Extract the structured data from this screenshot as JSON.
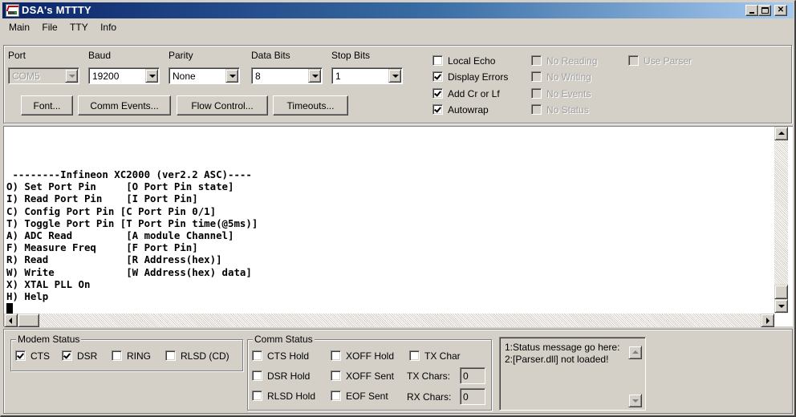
{
  "window": {
    "title": "DSA's MTTTY",
    "controls": {
      "minimize": "minimize",
      "maximize": "maximize",
      "close": "close"
    }
  },
  "menu": [
    "Main",
    "File",
    "TTY",
    "Info"
  ],
  "settings": {
    "port": {
      "label": "Port",
      "value": "COM5",
      "enabled": false
    },
    "baud": {
      "label": "Baud",
      "value": "19200"
    },
    "parity": {
      "label": "Parity",
      "value": "None"
    },
    "data_bits": {
      "label": "Data Bits",
      "value": "8"
    },
    "stop_bits": {
      "label": "Stop Bits",
      "value": "1"
    },
    "buttons": [
      "Font...",
      "Comm Events...",
      "Flow Control...",
      "Timeouts..."
    ],
    "options": [
      {
        "label": "Local Echo",
        "checked": false,
        "enabled": true
      },
      {
        "label": "Display Errors",
        "checked": true,
        "enabled": true
      },
      {
        "label": "Add Cr or Lf",
        "checked": true,
        "enabled": true
      },
      {
        "label": "Autowrap",
        "checked": true,
        "enabled": true
      },
      {
        "label": "No Reading",
        "checked": false,
        "enabled": false
      },
      {
        "label": "No Writing",
        "checked": false,
        "enabled": false
      },
      {
        "label": "No Events",
        "checked": false,
        "enabled": false
      },
      {
        "label": "No Status",
        "checked": false,
        "enabled": false
      },
      {
        "label": "Use Parser",
        "checked": false,
        "enabled": false
      }
    ]
  },
  "terminal": {
    "lines": [
      " --------Infineon XC2000 (ver2.2 ASC)----",
      "O) Set Port Pin     [O Port Pin state]",
      "I) Read Port Pin    [I Port Pin]",
      "C) Config Port Pin [C Port Pin 0/1]",
      "T) Toggle Port Pin [T Port Pin time(@5ms)]",
      "A) ADC Read         [A module Channel]",
      "F) Measure Freq     [F Port Pin]",
      "R) Read             [R Address(hex)]",
      "W) Write            [W Address(hex) data]",
      "X) XTAL PLL On",
      "H) Help"
    ]
  },
  "modem_status": {
    "title": "Modem Status",
    "items": [
      {
        "label": "CTS",
        "checked": true
      },
      {
        "label": "DSR",
        "checked": true
      },
      {
        "label": "RING",
        "checked": false
      },
      {
        "label": "RLSD (CD)",
        "checked": false
      }
    ]
  },
  "comm_status": {
    "title": "Comm Status",
    "items": [
      {
        "label": "CTS Hold",
        "checked": false
      },
      {
        "label": "XOFF Hold",
        "checked": false
      },
      {
        "label": "TX Char",
        "checked": false
      },
      {
        "label": "DSR Hold",
        "checked": false
      },
      {
        "label": "XOFF Sent",
        "checked": false
      },
      {
        "label": "RLSD Hold",
        "checked": false
      },
      {
        "label": "EOF Sent",
        "checked": false
      }
    ],
    "tx_chars": {
      "label": "TX Chars:",
      "value": "0"
    },
    "rx_chars": {
      "label": "RX Chars:",
      "value": "0"
    }
  },
  "messages": {
    "lines": [
      "1:Status message go here:",
      "2:[Parser.dll] not loaded!"
    ]
  }
}
